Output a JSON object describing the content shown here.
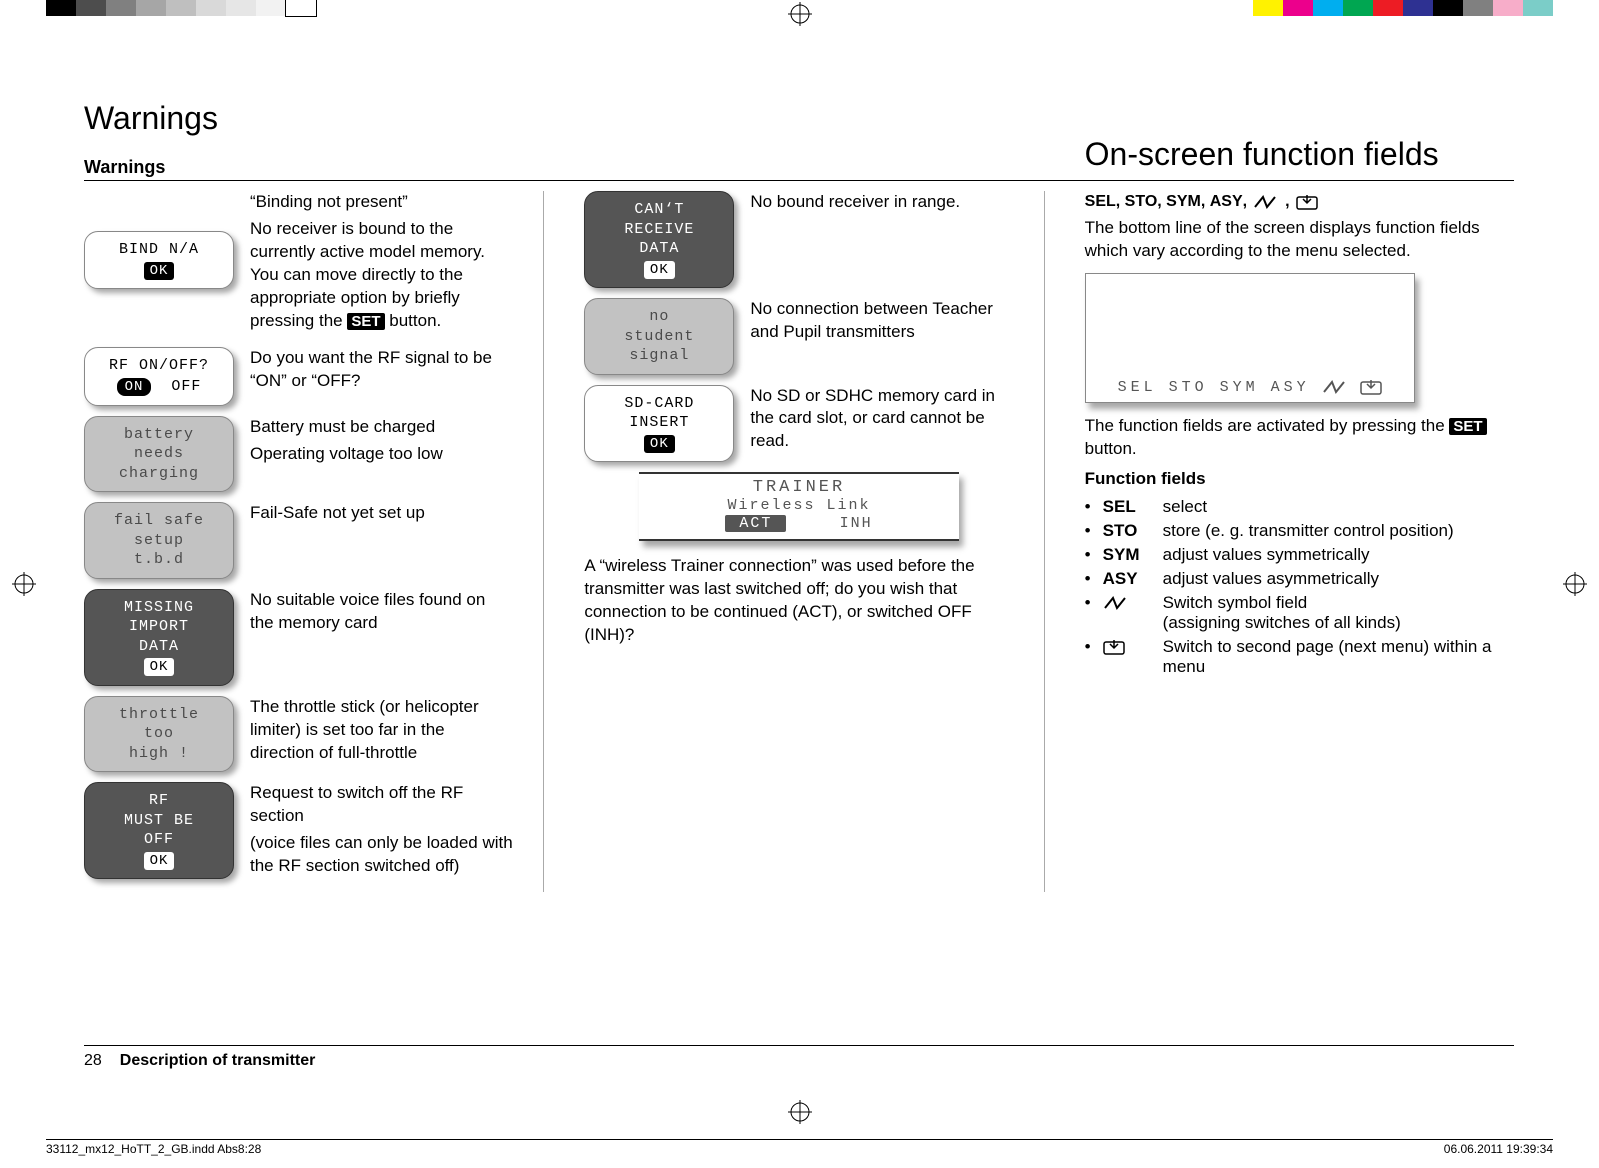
{
  "page": {
    "heading": "Warnings",
    "subheading": "Warnings",
    "number": "28",
    "footer_title": "Description of transmitter"
  },
  "col1": {
    "items": [
      {
        "lcd_style": "white",
        "lcd": "BIND  N/A",
        "ok": "OK",
        "desc": [
          "“Binding not present”",
          "No receiver is bound to the currently active model memory. You can move directly to the appropriate option by briefly pressing the |SET| button."
        ]
      },
      {
        "lcd_style": "white",
        "lcd": "RF  ON/OFF?",
        "on": "ON",
        "off": "OFF",
        "desc": [
          "Do you want the RF signal to be “ON” or “OFF?"
        ]
      },
      {
        "lcd_style": "grey",
        "lcd": "battery\nneeds\ncharging",
        "desc": [
          "Battery must be charged",
          "Operating voltage too low"
        ]
      },
      {
        "lcd_style": "grey",
        "lcd": "fail safe\nsetup\nt.b.d",
        "desc": [
          "Fail-Safe not yet set up"
        ]
      },
      {
        "lcd_style": "dark",
        "lcd": "MISSING\nIMPORT\nDATA",
        "ok": "OK",
        "ok_inv": true,
        "desc": [
          "No suitable voice files found on the memory card"
        ]
      },
      {
        "lcd_style": "grey",
        "lcd": "throttle\n  too\n    high !",
        "desc": [
          "The throttle stick (or helicopter limiter) is set too far in the direction of full-throttle"
        ]
      },
      {
        "lcd_style": "dark",
        "lcd": "RF\nMUST BE\nOFF",
        "ok": "OK",
        "ok_inv": true,
        "desc": [
          "Request to switch off the RF section",
          "(voice files can only be loaded with the RF section switched off)"
        ]
      }
    ]
  },
  "col2": {
    "items": [
      {
        "lcd_style": "dark",
        "lcd": "CAN‘T\nRECEIVE\nDATA",
        "ok": "OK",
        "ok_inv": true,
        "desc": [
          "No bound receiver in range."
        ]
      },
      {
        "lcd_style": "grey",
        "lcd": "no\n student\n   signal",
        "desc": [
          "No connection between Teacher and Pupil transmitters"
        ]
      },
      {
        "lcd_style": "white",
        "lcd": "SD-CARD\nINSERT",
        "ok": "OK",
        "desc": [
          "No SD or SDHC memory card in the card slot, or card cannot be read."
        ]
      }
    ],
    "trainer": {
      "line1": "TRAINER",
      "line2": "Wireless Link",
      "act": "ACT",
      "inh": "INH"
    },
    "trainer_text": "A “wireless Trainer connection” was used before the transmitter was last switched off; do you wish that connection to be continued (ACT), or switched OFF (INH)?"
  },
  "col3": {
    "heading": "On-screen function fields",
    "sub_keys": "SEL, STO, SYM, ASY, ",
    "intro": "The bottom line of the screen displays function fields which vary according to the menu selected.",
    "screen_labels": [
      "SEL",
      "STO",
      "SYM",
      "ASY"
    ],
    "after_screen": "The function fields are activated by pressing the |SET| button.",
    "func_heading": "Function fields",
    "funcs": [
      {
        "key": "SEL",
        "val": "select"
      },
      {
        "key": "STO",
        "val": "store (e. g. transmitter control position)"
      },
      {
        "key": "SYM",
        "val": "adjust values symmetrically"
      },
      {
        "key": "ASY",
        "val": "adjust values asymmetrically"
      },
      {
        "key": "SWITCH_ICON",
        "val": "Switch symbol field\n(assigning switches of all kinds)"
      },
      {
        "key": "PAGE_ICON",
        "val": "Switch to second page (next menu) within a menu"
      }
    ]
  },
  "indd": {
    "left": "33112_mx12_HoTT_2_GB.indd   Abs8:28",
    "right": "06.06.2011   19:39:34"
  },
  "colors": {
    "left_bar": [
      "#000",
      "#4d4d4d",
      "#808080",
      "#a6a6a6",
      "#bfbfbf",
      "#d9d9d9",
      "#e6e6e6",
      "#f2f2f2",
      "#fff"
    ],
    "right_bar": [
      "#fff200",
      "#ec008c",
      "#00aeef",
      "#00a651",
      "#ed1c24",
      "#2e3192",
      "#000",
      "#808080",
      "#f7adc9",
      "#7bcdc8"
    ]
  }
}
